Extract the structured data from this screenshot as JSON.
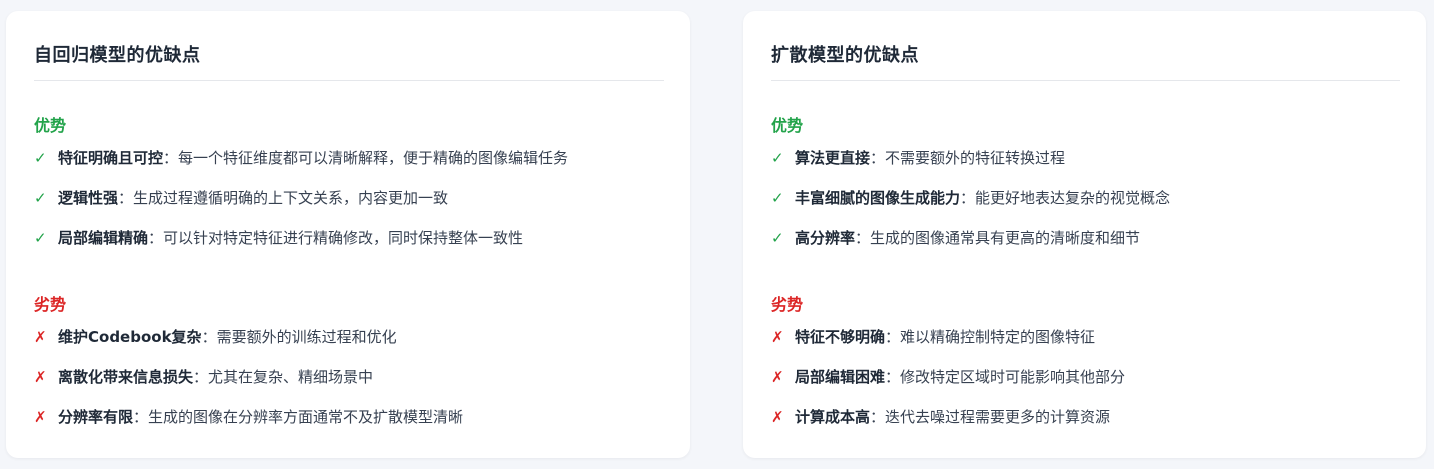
{
  "colors": {
    "advantage": "#22a34a",
    "disadvantage": "#dc2626",
    "card_bg": "#ffffff",
    "page_bg": "#f4f6fa"
  },
  "icons": {
    "advantage_mark": "checkmark",
    "disadvantage_mark": "x-mark"
  },
  "cards": [
    {
      "title": "自回归模型的优缺点",
      "advantages": {
        "heading": "优势",
        "items": [
          {
            "mark": "✓",
            "title": "特征明确且可控",
            "sep": "：",
            "desc": "每一个特征维度都可以清晰解释，便于精确的图像编辑任务"
          },
          {
            "mark": "✓",
            "title": "逻辑性强",
            "sep": "：",
            "desc": "生成过程遵循明确的上下文关系，内容更加一致"
          },
          {
            "mark": "✓",
            "title": "局部编辑精确",
            "sep": "：",
            "desc": "可以针对特定特征进行精确修改，同时保持整体一致性"
          }
        ]
      },
      "disadvantages": {
        "heading": "劣势",
        "items": [
          {
            "mark": "✗",
            "title": "维护Codebook复杂",
            "sep": "：",
            "desc": "需要额外的训练过程和优化"
          },
          {
            "mark": "✗",
            "title": "离散化带来信息损失",
            "sep": "：",
            "desc": "尤其在复杂、精细场景中"
          },
          {
            "mark": "✗",
            "title": "分辨率有限",
            "sep": "：",
            "desc": "生成的图像在分辨率方面通常不及扩散模型清晰"
          }
        ]
      }
    },
    {
      "title": "扩散模型的优缺点",
      "advantages": {
        "heading": "优势",
        "items": [
          {
            "mark": "✓",
            "title": "算法更直接",
            "sep": "：",
            "desc": "不需要额外的特征转换过程"
          },
          {
            "mark": "✓",
            "title": "丰富细腻的图像生成能力",
            "sep": "：",
            "desc": "能更好地表达复杂的视觉概念"
          },
          {
            "mark": "✓",
            "title": "高分辨率",
            "sep": "：",
            "desc": "生成的图像通常具有更高的清晰度和细节"
          }
        ]
      },
      "disadvantages": {
        "heading": "劣势",
        "items": [
          {
            "mark": "✗",
            "title": "特征不够明确",
            "sep": "：",
            "desc": "难以精确控制特定的图像特征"
          },
          {
            "mark": "✗",
            "title": "局部编辑困难",
            "sep": "：",
            "desc": "修改特定区域时可能影响其他部分"
          },
          {
            "mark": "✗",
            "title": "计算成本高",
            "sep": "：",
            "desc": "迭代去噪过程需要更多的计算资源"
          }
        ]
      }
    }
  ]
}
